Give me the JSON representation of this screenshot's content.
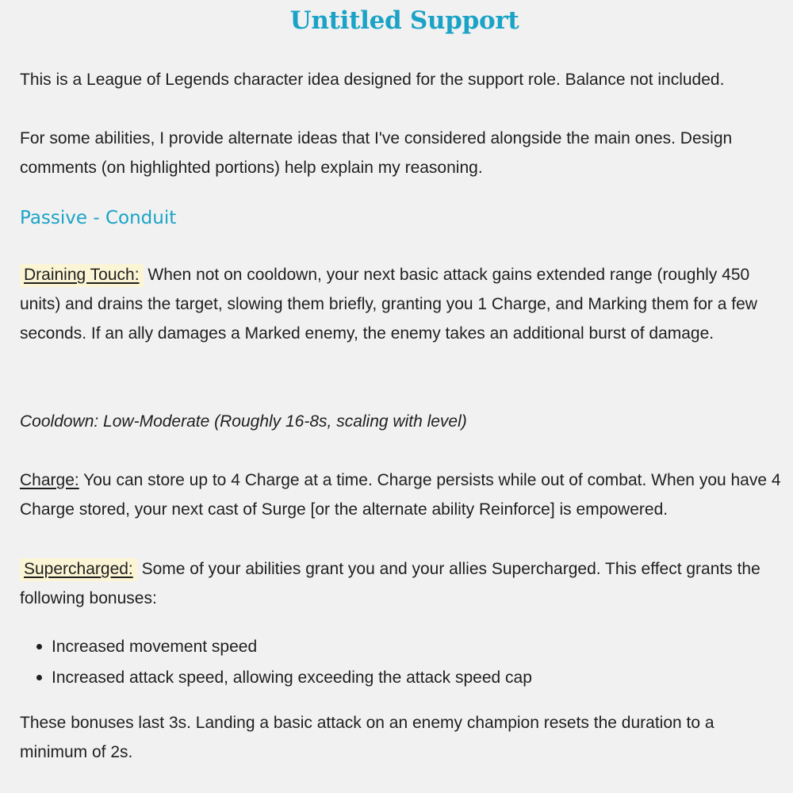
{
  "document": {
    "title": "Untitled Support",
    "intro_1": "This is a League of Legends character idea designed for the support role. Balance not included.",
    "intro_2": "For some abilities, I provide alternate ideas that I've considered alongside the main ones. Design comments (on highlighted portions) help explain my reasoning.",
    "passive_heading": "Passive - Conduit",
    "draining_touch": {
      "label": "Draining Touch:",
      "text": " When not on cooldown, your next basic attack gains extended range (roughly 450 units) and drains the target, slowing them briefly, granting you 1 Charge, and Marking them for a few seconds. If an ally damages a Marked enemy, the enemy takes an additional burst of damage."
    },
    "cooldown": "Cooldown: Low-Moderate (Roughly 16-8s, scaling with level)",
    "charge": {
      "label": "Charge:",
      "text": " You can store up to 4 Charge at a time. Charge persists while out of combat. When you have 4 Charge stored, your next cast of Surge [or the alternate ability Reinforce] is empowered."
    },
    "supercharged": {
      "label": "Supercharged:",
      "text": " Some of your abilities grant you and your allies Supercharged. This effect grants the following bonuses:"
    },
    "bonuses": [
      "Increased movement speed",
      "Increased attack speed, allowing exceeding the attack speed cap"
    ],
    "closing": "These bonuses last 3s. Landing a basic attack on an enemy champion resets the duration to a minimum of 2s."
  },
  "colors": {
    "heading": "#1aa3c6",
    "highlight": "#fbf5d6",
    "background": "#f1f1f1"
  }
}
